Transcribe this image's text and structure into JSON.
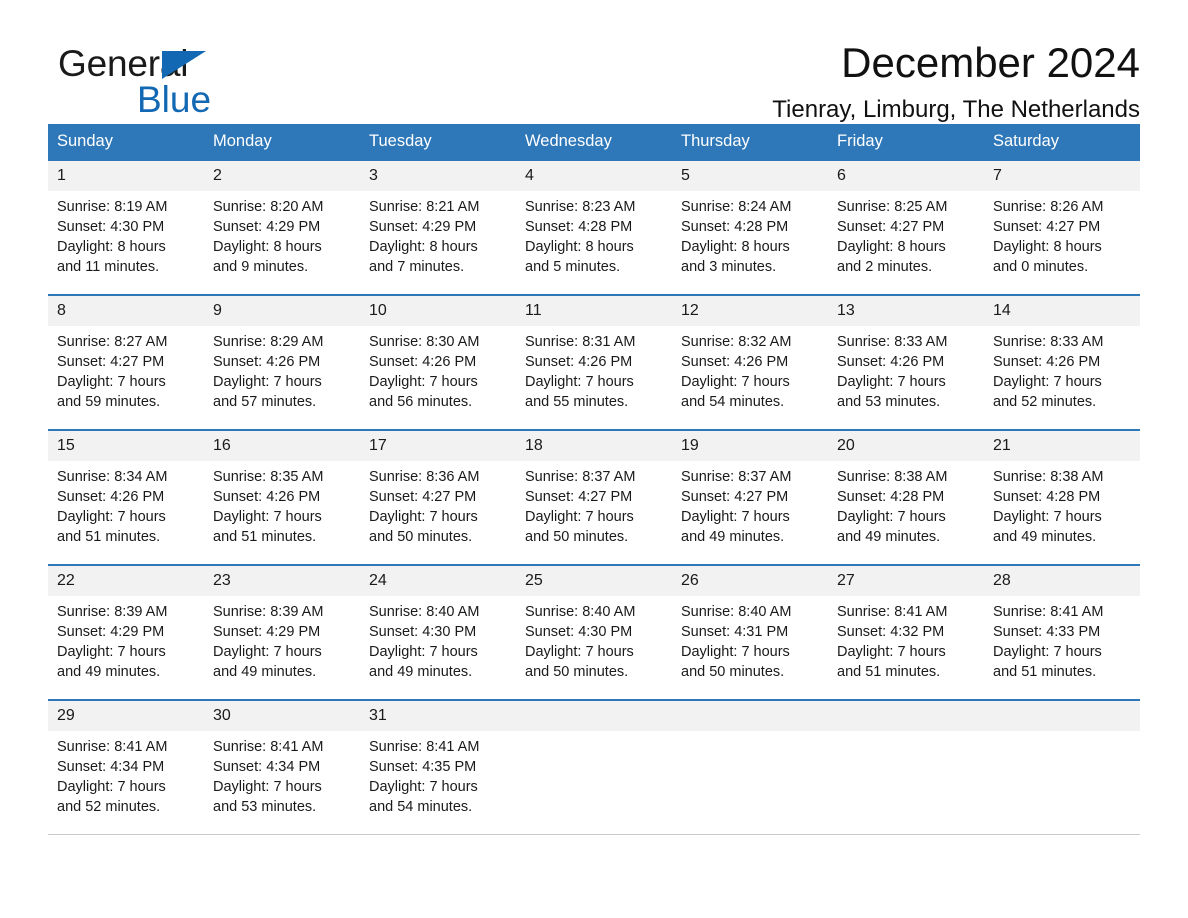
{
  "brand": {
    "name_part1": "General",
    "name_part2": "Blue",
    "flag_color": "#1268b3"
  },
  "header": {
    "title": "December 2024",
    "subtitle": "Tienray, Limburg, The Netherlands",
    "accent_color": "#2e77b8",
    "daynum_background": "#f2f2f2"
  },
  "calendar": {
    "weekday_headers": [
      "Sunday",
      "Monday",
      "Tuesday",
      "Wednesday",
      "Thursday",
      "Friday",
      "Saturday"
    ],
    "weeks": [
      [
        {
          "day": "1",
          "sunrise": "Sunrise: 8:19 AM",
          "sunset": "Sunset: 4:30 PM",
          "daylight_line1": "Daylight: 8 hours",
          "daylight_line2": "and 11 minutes."
        },
        {
          "day": "2",
          "sunrise": "Sunrise: 8:20 AM",
          "sunset": "Sunset: 4:29 PM",
          "daylight_line1": "Daylight: 8 hours",
          "daylight_line2": "and 9 minutes."
        },
        {
          "day": "3",
          "sunrise": "Sunrise: 8:21 AM",
          "sunset": "Sunset: 4:29 PM",
          "daylight_line1": "Daylight: 8 hours",
          "daylight_line2": "and 7 minutes."
        },
        {
          "day": "4",
          "sunrise": "Sunrise: 8:23 AM",
          "sunset": "Sunset: 4:28 PM",
          "daylight_line1": "Daylight: 8 hours",
          "daylight_line2": "and 5 minutes."
        },
        {
          "day": "5",
          "sunrise": "Sunrise: 8:24 AM",
          "sunset": "Sunset: 4:28 PM",
          "daylight_line1": "Daylight: 8 hours",
          "daylight_line2": "and 3 minutes."
        },
        {
          "day": "6",
          "sunrise": "Sunrise: 8:25 AM",
          "sunset": "Sunset: 4:27 PM",
          "daylight_line1": "Daylight: 8 hours",
          "daylight_line2": "and 2 minutes."
        },
        {
          "day": "7",
          "sunrise": "Sunrise: 8:26 AM",
          "sunset": "Sunset: 4:27 PM",
          "daylight_line1": "Daylight: 8 hours",
          "daylight_line2": "and 0 minutes."
        }
      ],
      [
        {
          "day": "8",
          "sunrise": "Sunrise: 8:27 AM",
          "sunset": "Sunset: 4:27 PM",
          "daylight_line1": "Daylight: 7 hours",
          "daylight_line2": "and 59 minutes."
        },
        {
          "day": "9",
          "sunrise": "Sunrise: 8:29 AM",
          "sunset": "Sunset: 4:26 PM",
          "daylight_line1": "Daylight: 7 hours",
          "daylight_line2": "and 57 minutes."
        },
        {
          "day": "10",
          "sunrise": "Sunrise: 8:30 AM",
          "sunset": "Sunset: 4:26 PM",
          "daylight_line1": "Daylight: 7 hours",
          "daylight_line2": "and 56 minutes."
        },
        {
          "day": "11",
          "sunrise": "Sunrise: 8:31 AM",
          "sunset": "Sunset: 4:26 PM",
          "daylight_line1": "Daylight: 7 hours",
          "daylight_line2": "and 55 minutes."
        },
        {
          "day": "12",
          "sunrise": "Sunrise: 8:32 AM",
          "sunset": "Sunset: 4:26 PM",
          "daylight_line1": "Daylight: 7 hours",
          "daylight_line2": "and 54 minutes."
        },
        {
          "day": "13",
          "sunrise": "Sunrise: 8:33 AM",
          "sunset": "Sunset: 4:26 PM",
          "daylight_line1": "Daylight: 7 hours",
          "daylight_line2": "and 53 minutes."
        },
        {
          "day": "14",
          "sunrise": "Sunrise: 8:33 AM",
          "sunset": "Sunset: 4:26 PM",
          "daylight_line1": "Daylight: 7 hours",
          "daylight_line2": "and 52 minutes."
        }
      ],
      [
        {
          "day": "15",
          "sunrise": "Sunrise: 8:34 AM",
          "sunset": "Sunset: 4:26 PM",
          "daylight_line1": "Daylight: 7 hours",
          "daylight_line2": "and 51 minutes."
        },
        {
          "day": "16",
          "sunrise": "Sunrise: 8:35 AM",
          "sunset": "Sunset: 4:26 PM",
          "daylight_line1": "Daylight: 7 hours",
          "daylight_line2": "and 51 minutes."
        },
        {
          "day": "17",
          "sunrise": "Sunrise: 8:36 AM",
          "sunset": "Sunset: 4:27 PM",
          "daylight_line1": "Daylight: 7 hours",
          "daylight_line2": "and 50 minutes."
        },
        {
          "day": "18",
          "sunrise": "Sunrise: 8:37 AM",
          "sunset": "Sunset: 4:27 PM",
          "daylight_line1": "Daylight: 7 hours",
          "daylight_line2": "and 50 minutes."
        },
        {
          "day": "19",
          "sunrise": "Sunrise: 8:37 AM",
          "sunset": "Sunset: 4:27 PM",
          "daylight_line1": "Daylight: 7 hours",
          "daylight_line2": "and 49 minutes."
        },
        {
          "day": "20",
          "sunrise": "Sunrise: 8:38 AM",
          "sunset": "Sunset: 4:28 PM",
          "daylight_line1": "Daylight: 7 hours",
          "daylight_line2": "and 49 minutes."
        },
        {
          "day": "21",
          "sunrise": "Sunrise: 8:38 AM",
          "sunset": "Sunset: 4:28 PM",
          "daylight_line1": "Daylight: 7 hours",
          "daylight_line2": "and 49 minutes."
        }
      ],
      [
        {
          "day": "22",
          "sunrise": "Sunrise: 8:39 AM",
          "sunset": "Sunset: 4:29 PM",
          "daylight_line1": "Daylight: 7 hours",
          "daylight_line2": "and 49 minutes."
        },
        {
          "day": "23",
          "sunrise": "Sunrise: 8:39 AM",
          "sunset": "Sunset: 4:29 PM",
          "daylight_line1": "Daylight: 7 hours",
          "daylight_line2": "and 49 minutes."
        },
        {
          "day": "24",
          "sunrise": "Sunrise: 8:40 AM",
          "sunset": "Sunset: 4:30 PM",
          "daylight_line1": "Daylight: 7 hours",
          "daylight_line2": "and 49 minutes."
        },
        {
          "day": "25",
          "sunrise": "Sunrise: 8:40 AM",
          "sunset": "Sunset: 4:30 PM",
          "daylight_line1": "Daylight: 7 hours",
          "daylight_line2": "and 50 minutes."
        },
        {
          "day": "26",
          "sunrise": "Sunrise: 8:40 AM",
          "sunset": "Sunset: 4:31 PM",
          "daylight_line1": "Daylight: 7 hours",
          "daylight_line2": "and 50 minutes."
        },
        {
          "day": "27",
          "sunrise": "Sunrise: 8:41 AM",
          "sunset": "Sunset: 4:32 PM",
          "daylight_line1": "Daylight: 7 hours",
          "daylight_line2": "and 51 minutes."
        },
        {
          "day": "28",
          "sunrise": "Sunrise: 8:41 AM",
          "sunset": "Sunset: 4:33 PM",
          "daylight_line1": "Daylight: 7 hours",
          "daylight_line2": "and 51 minutes."
        }
      ],
      [
        {
          "day": "29",
          "sunrise": "Sunrise: 8:41 AM",
          "sunset": "Sunset: 4:34 PM",
          "daylight_line1": "Daylight: 7 hours",
          "daylight_line2": "and 52 minutes."
        },
        {
          "day": "30",
          "sunrise": "Sunrise: 8:41 AM",
          "sunset": "Sunset: 4:34 PM",
          "daylight_line1": "Daylight: 7 hours",
          "daylight_line2": "and 53 minutes."
        },
        {
          "day": "31",
          "sunrise": "Sunrise: 8:41 AM",
          "sunset": "Sunset: 4:35 PM",
          "daylight_line1": "Daylight: 7 hours",
          "daylight_line2": "and 54 minutes."
        },
        {
          "day": "",
          "sunrise": "",
          "sunset": "",
          "daylight_line1": "",
          "daylight_line2": ""
        },
        {
          "day": "",
          "sunrise": "",
          "sunset": "",
          "daylight_line1": "",
          "daylight_line2": ""
        },
        {
          "day": "",
          "sunrise": "",
          "sunset": "",
          "daylight_line1": "",
          "daylight_line2": ""
        },
        {
          "day": "",
          "sunrise": "",
          "sunset": "",
          "daylight_line1": "",
          "daylight_line2": ""
        }
      ]
    ]
  }
}
